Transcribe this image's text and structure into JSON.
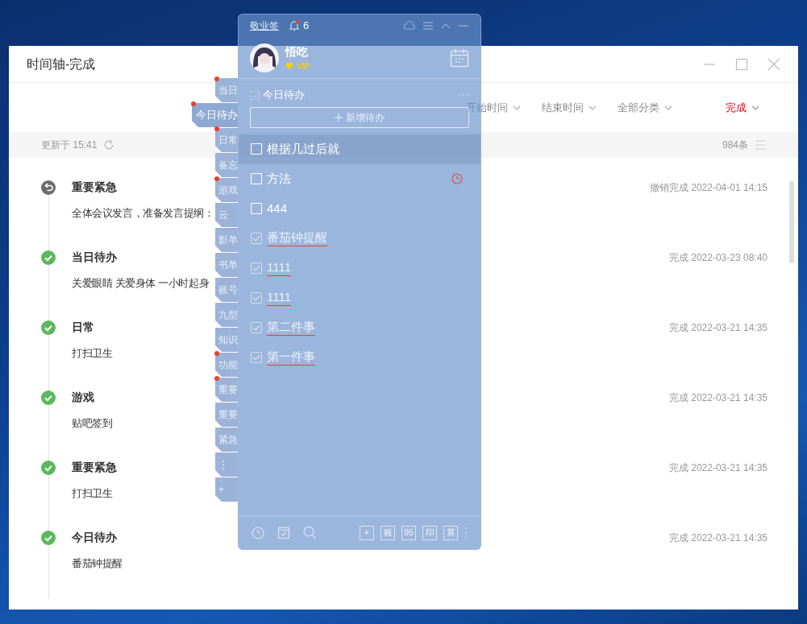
{
  "main_window": {
    "title": "时间轴-完成",
    "filters": [
      {
        "label": "开始时间",
        "selected": false
      },
      {
        "label": "结束时间",
        "selected": false
      },
      {
        "label": "全部分类",
        "selected": false
      },
      {
        "label": "完成",
        "selected": true
      }
    ],
    "updated": "更新于 15:41",
    "count": "984条",
    "entries": [
      {
        "kind": "undone",
        "category": "重要紧急",
        "content": "全体会议发言，准备发言提纲：",
        "time": "撤销完成 2022-04-01 14:15"
      },
      {
        "kind": "done",
        "category": "当日待办",
        "content": "关爱眼睛 关爱身体 一小时起身",
        "time": "完成 2022-03-23 08:40"
      },
      {
        "kind": "done",
        "category": "日常",
        "content": "打扫卫生",
        "time": "完成 2022-03-21 14:35"
      },
      {
        "kind": "done",
        "category": "游戏",
        "content": "贴吧签到",
        "time": "完成 2022-03-21 14:35"
      },
      {
        "kind": "done",
        "category": "重要紧急",
        "content": "打扫卫生",
        "time": "完成 2022-03-21 14:35"
      },
      {
        "kind": "done",
        "category": "今日待办",
        "content": "番茄钟提醒",
        "time": "完成 2022-03-21 14:35"
      }
    ]
  },
  "category_tabs": [
    {
      "label": "当日",
      "selected": false,
      "dot": true
    },
    {
      "label": "今日待办",
      "selected": true,
      "dot": true
    },
    {
      "label": "日常",
      "selected": false,
      "dot": true
    },
    {
      "label": "备忘",
      "selected": false,
      "dot": false
    },
    {
      "label": "游戏",
      "selected": false,
      "dot": true
    },
    {
      "label": "云",
      "selected": false,
      "dot": false
    },
    {
      "label": "影单",
      "selected": false,
      "dot": false
    },
    {
      "label": "书单",
      "selected": false,
      "dot": false
    },
    {
      "label": "账号",
      "selected": false,
      "dot": false
    },
    {
      "label": "九型",
      "selected": false,
      "dot": false
    },
    {
      "label": "知识",
      "selected": false,
      "dot": false
    },
    {
      "label": "功能",
      "selected": false,
      "dot": true
    },
    {
      "label": "重要",
      "selected": false,
      "dot": true
    },
    {
      "label": "重要",
      "selected": false,
      "dot": false
    },
    {
      "label": "紧急",
      "selected": false,
      "dot": false
    },
    {
      "label": "⋮",
      "selected": false,
      "dot": false
    },
    {
      "label": "+",
      "selected": false,
      "dot": false
    }
  ],
  "widget": {
    "app_name": "敬业签",
    "notification_count": "6",
    "user": {
      "name": "悟吃",
      "badge": "VIP"
    },
    "list_title": "今日待办",
    "add_button": "新增待办",
    "todos": [
      {
        "text": "根据几过后就",
        "checked": false,
        "highlighted": true,
        "reminder": false
      },
      {
        "text": "方法",
        "checked": false,
        "highlighted": false,
        "reminder": true
      },
      {
        "text": "444",
        "checked": false,
        "highlighted": false,
        "reminder": false
      },
      {
        "text": "番茄钟提醒",
        "checked": true,
        "highlighted": false,
        "reminder": false
      },
      {
        "text": "1111",
        "checked": true,
        "highlighted": false,
        "reminder": false
      },
      {
        "text": "1111",
        "checked": true,
        "highlighted": false,
        "reminder": false
      },
      {
        "text": "第二件事",
        "checked": true,
        "highlighted": false,
        "reminder": false
      },
      {
        "text": "第一件事",
        "checked": true,
        "highlighted": false,
        "reminder": false
      }
    ],
    "tools": [
      "+",
      "账",
      "95",
      "印",
      "算"
    ]
  }
}
